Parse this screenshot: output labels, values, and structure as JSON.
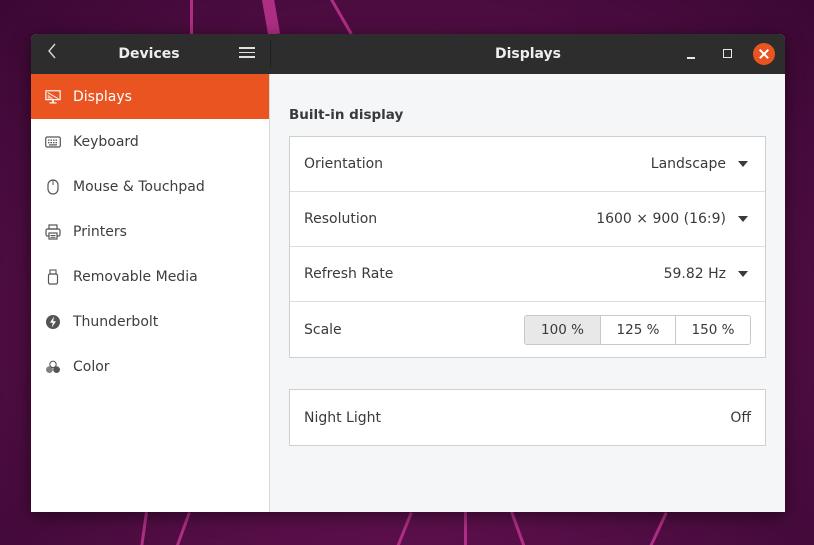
{
  "window": {
    "sidebar_title": "Devices",
    "main_title": "Displays",
    "controls": {
      "minimize": "minimize-icon",
      "maximize": "maximize-icon",
      "close": "close-icon"
    },
    "accent_color": "#e95420"
  },
  "sidebar": {
    "items": [
      {
        "label": "Displays",
        "icon": "display-icon",
        "active": true
      },
      {
        "label": "Keyboard",
        "icon": "keyboard-icon",
        "active": false
      },
      {
        "label": "Mouse & Touchpad",
        "icon": "mouse-icon",
        "active": false
      },
      {
        "label": "Printers",
        "icon": "printer-icon",
        "active": false
      },
      {
        "label": "Removable Media",
        "icon": "usb-drive-icon",
        "active": false
      },
      {
        "label": "Thunderbolt",
        "icon": "thunderbolt-icon",
        "active": false
      },
      {
        "label": "Color",
        "icon": "color-icon",
        "active": false
      }
    ]
  },
  "main": {
    "section_title": "Built-in display",
    "settings": {
      "orientation": {
        "label": "Orientation",
        "value": "Landscape"
      },
      "resolution": {
        "label": "Resolution",
        "value": "1600 × 900 (16:9)"
      },
      "refresh_rate": {
        "label": "Refresh Rate",
        "value": "59.82 Hz"
      },
      "scale": {
        "label": "Scale",
        "options": [
          "100 %",
          "125 %",
          "150 %"
        ],
        "selected": "100 %"
      }
    },
    "night_light": {
      "label": "Night Light",
      "value": "Off"
    }
  }
}
